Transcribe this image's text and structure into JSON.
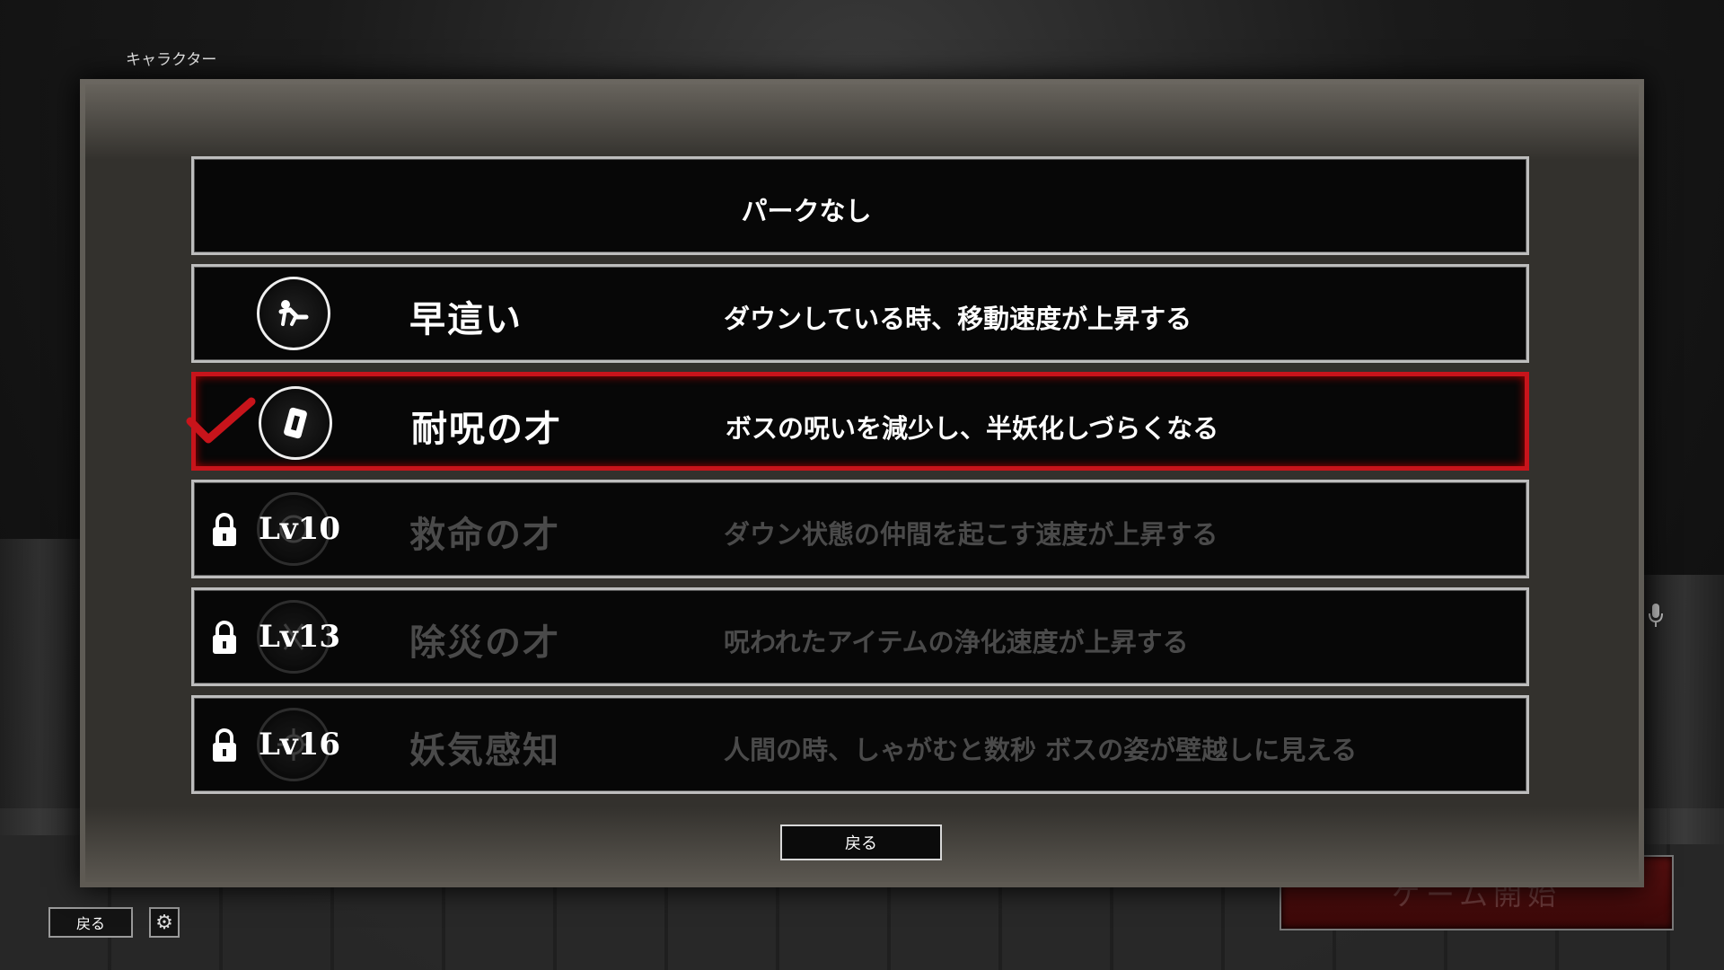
{
  "screen_title": "キャラクター",
  "perks": [
    {
      "name": "",
      "description": "パークなし",
      "icon": "none",
      "locked": false,
      "selected": false
    },
    {
      "name": "早這い",
      "description": "ダウンしている時、移動速度が上昇する",
      "icon": "crawling-figure-icon",
      "locked": false,
      "selected": false
    },
    {
      "name": "耐呪の才",
      "description": "ボスの呪いを減少し、半妖化しづらくなる",
      "icon": "talisman-icon",
      "locked": false,
      "selected": true
    },
    {
      "name": "救命の才",
      "description": "ダウン状態の仲間を起こす速度が上昇する",
      "icon": "rescue-icon",
      "locked": true,
      "level": "Lv10",
      "selected": false
    },
    {
      "name": "除災の才",
      "description": "呪われたアイテムの浄化速度が上昇する",
      "icon": "purify-icon",
      "locked": true,
      "level": "Lv13",
      "selected": false
    },
    {
      "name": "妖気感知",
      "description": "人間の時、しゃがむと数秒 ボスの姿が壁越しに見える",
      "icon": "sense-icon",
      "locked": true,
      "level": "Lv16",
      "selected": false
    }
  ],
  "dialog_back_label": "戻る",
  "bottom_back_label": "戻る",
  "start_game_label": "ゲーム開始",
  "colors": {
    "selected_border": "#c8141b",
    "panel": "#33312d",
    "locked_text": "#4a4a4a"
  }
}
